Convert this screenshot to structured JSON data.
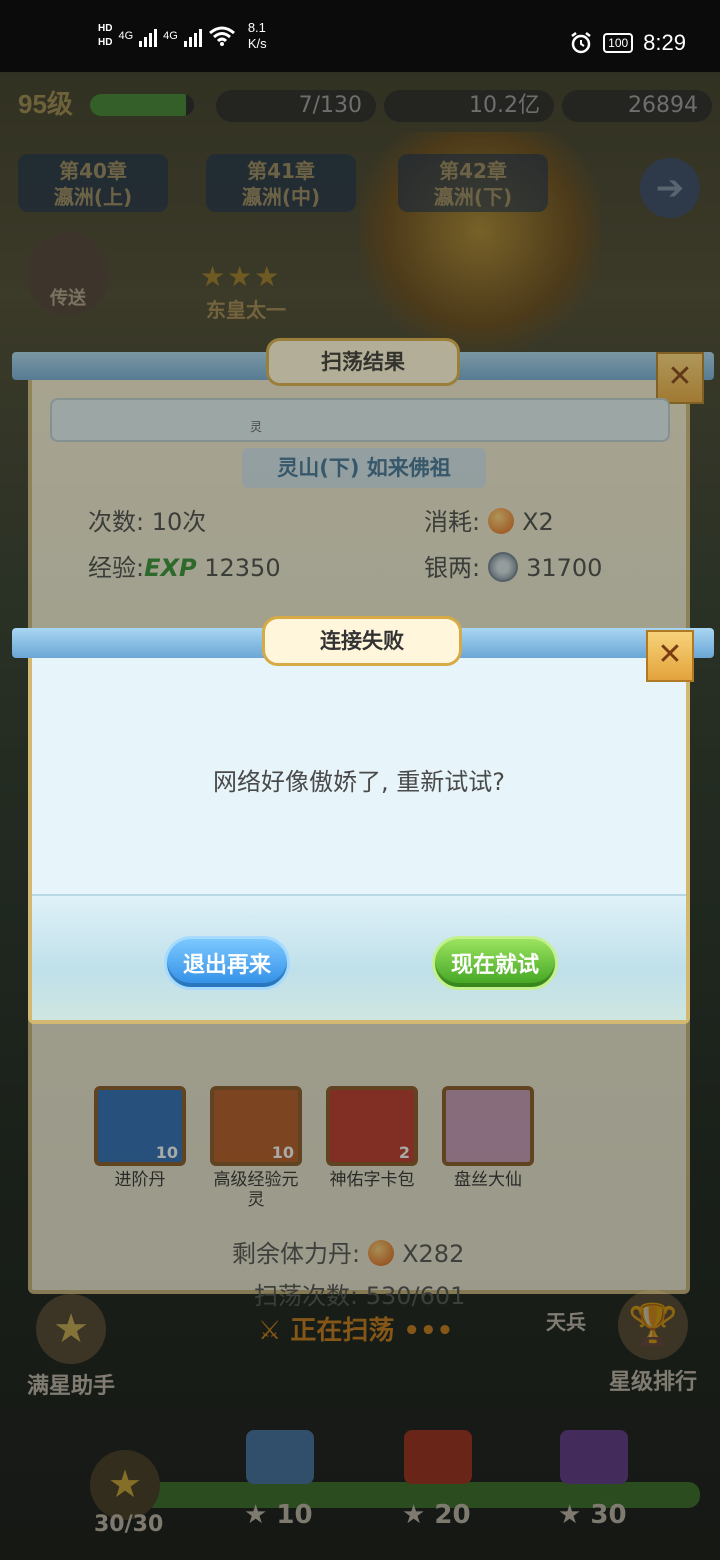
{
  "status_bar": {
    "speed": "8.1",
    "speed_unit": "K/s",
    "battery": "100",
    "time": "8:29",
    "hd1": "HD",
    "hd2": "HD",
    "net1": "4G",
    "net2": "4G"
  },
  "hud": {
    "level": "95级",
    "xp_progress": 0.92,
    "stamina": "7/130",
    "silver": "10.2亿",
    "gold": "26894"
  },
  "chapters": [
    {
      "num": "第40章",
      "name": "瀛洲(上)"
    },
    {
      "num": "第41章",
      "name": "瀛洲(中)"
    },
    {
      "num": "第42章",
      "name": "瀛洲(下)"
    }
  ],
  "portal_label": "传送",
  "boss_name": "东皇太一",
  "sweep_panel": {
    "title": "扫荡结果",
    "inner_fragment": "灵",
    "stage": "灵山(下) 如来佛祖",
    "times_label": "次数:",
    "times_value": "10次",
    "cost_label": "消耗:",
    "cost_value": "X2",
    "exp_label": "经验:",
    "exp_tag": "EXP",
    "exp_value": "12350",
    "silver_label": "银两:",
    "silver_value": "31700",
    "rewards": [
      {
        "name": "进阶丹",
        "qty": "10",
        "color": "#2f6fb8"
      },
      {
        "name": "高级经验元灵",
        "qty": "10",
        "color": "#b85a24"
      },
      {
        "name": "神佑字卡包",
        "qty": "2",
        "color": "#c0362c"
      },
      {
        "name": "盘丝大仙",
        "qty": "",
        "color": "#c99ab8"
      }
    ],
    "remain_label": "剩余体力丹:",
    "remain_value": "X282",
    "count_label": "扫荡次数:",
    "count_value": "530/601",
    "status": "正在扫荡 •••"
  },
  "dialog": {
    "title": "连接失败",
    "message": "网络好像傲娇了, 重新试试?",
    "exit_button": "退出再来",
    "retry_button": "现在就试"
  },
  "bottom": {
    "helper": "满星助手",
    "rank": "星级排行",
    "tianbing": "天兵",
    "stars": "30/30",
    "star_progress": 1.0,
    "chests": [
      {
        "label": "10",
        "color": "#5a8fc4"
      },
      {
        "label": "20",
        "color": "#c0452c"
      },
      {
        "label": "30",
        "color": "#7a4fa8"
      }
    ]
  },
  "colors": {
    "accent_gold": "#d6ab45",
    "button_blue": "#2f8ee6",
    "button_green": "#3fa321"
  },
  "icons": {
    "close": "close-x-icon",
    "alarm": "alarm-clock-icon",
    "wifi": "wifi-icon"
  }
}
